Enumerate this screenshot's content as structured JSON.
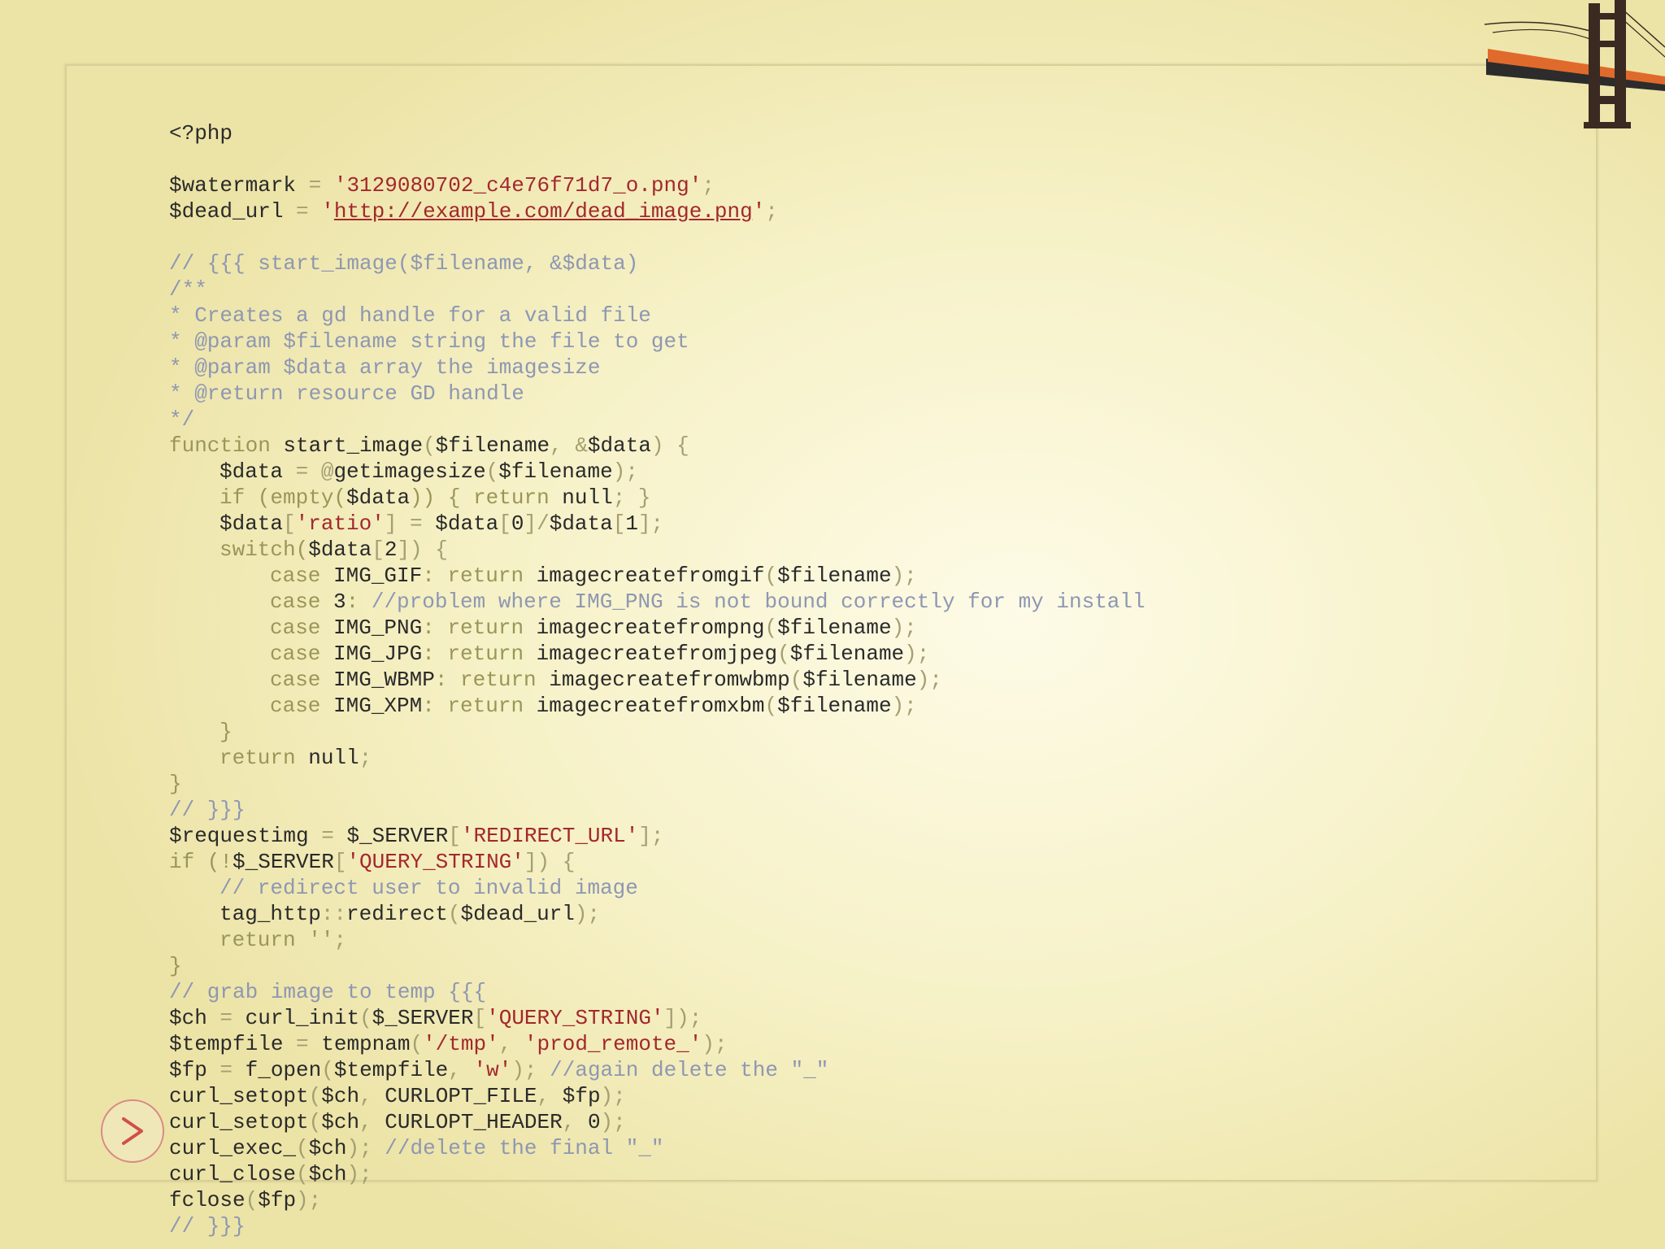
{
  "colors": {
    "background": "#f6f1c6",
    "frame": "#d9cf98",
    "default_text": "#2a2a2a",
    "keyword": "#9a9658",
    "string": "#a3282e",
    "comment": "#8e97b2",
    "bridge_orange": "#e06a2c",
    "bridge_tower": "#3a2a22",
    "next_button": "#d0504a"
  },
  "icons": {
    "corner_illustration": "golden-gate-bridge-icon",
    "navigation": "next-arrow-icon"
  },
  "code": {
    "line1": "<?php",
    "line3": {
      "var": "$watermark",
      "op": " = ",
      "str": "'3129080702_c4e76f71d7_o.png'",
      "end": ";"
    },
    "line4": {
      "var": "$dead_url",
      "op": " = ",
      "q1": "'",
      "url": "http://example.com/dead_image.png",
      "q2": "'",
      "end": ";"
    },
    "line6": "// {{{ start_image($filename, &$data)",
    "line7": "/**",
    "line8": "* Creates a gd handle for a valid file",
    "line9": "* @param $filename string the file to get",
    "line10": "* @param $data array the imagesize",
    "line11": "* @return resource GD handle",
    "line12": "*/",
    "line13": {
      "kw": "function",
      "name": " start_image",
      "p1": "(",
      "a1": "$filename",
      "c": ", &",
      "a2": "$data",
      "p2": ") {"
    },
    "line14": {
      "var": "$data",
      "op": " = @",
      "fn": "getimagesize",
      "p1": "(",
      "a": "$filename",
      "p2": ");"
    },
    "line15": {
      "kw1": "if (empty(",
      "var": "$data",
      "kw2": ")) { return ",
      "val": "null",
      "end": "; }"
    },
    "line16": {
      "var": "$data",
      "b1": "[",
      "str": "'ratio'",
      "b2": "] = ",
      "v2": "$data",
      "b3": "[",
      "n0": "0",
      "b4": "]/",
      "v3": "$data",
      "b5": "[",
      "n1": "1",
      "b6": "];"
    },
    "line17": {
      "kw": "switch(",
      "var": "$data",
      "b1": "[",
      "n": "2",
      "b2": "]) {"
    },
    "line18": {
      "kw": "case ",
      "const": "IMG_GIF",
      "mid": ": return ",
      "fn": "imagecreatefromgif",
      "p1": "(",
      "a": "$filename",
      "p2": ");"
    },
    "line19": {
      "kw": "case ",
      "const": "3",
      "mid": ": ",
      "cm": "//problem where IMG_PNG is not bound correctly for my install"
    },
    "line20": {
      "kw": "case ",
      "const": "IMG_PNG",
      "mid": ": return ",
      "fn": "imagecreatefrompng",
      "p1": "(",
      "a": "$filename",
      "p2": ");"
    },
    "line21": {
      "kw": "case ",
      "const": "IMG_JPG",
      "mid": ": return ",
      "fn": "imagecreatefromjpeg",
      "p1": "(",
      "a": "$filename",
      "p2": ");"
    },
    "line22": {
      "kw": "case ",
      "const": "IMG_WBMP",
      "mid": ": return ",
      "fn": "imagecreatefromwbmp",
      "p1": "(",
      "a": "$filename",
      "p2": ");"
    },
    "line23": {
      "kw": "case ",
      "const": "IMG_XPM",
      "mid": ": return ",
      "fn": "imagecreatefromxbm",
      "p1": "(",
      "a": "$filename",
      "p2": ");"
    },
    "line24": "}",
    "line25": {
      "kw": "return ",
      "val": "null",
      "end": ";"
    },
    "line26": "}",
    "line27": "// }}}",
    "line28": {
      "var": "$requestimg",
      "op": " = ",
      "var2": "$_SERVER",
      "b1": "[",
      "str": "'REDIRECT_URL'",
      "b2": "];"
    },
    "line29": {
      "kw": "if (!",
      "var": "$_SERVER",
      "b1": "[",
      "str": "'QUERY_STRING'",
      "b2": "]) {"
    },
    "line30": "// redirect user to invalid image",
    "line31": {
      "cls": "tag_http",
      "op": "::",
      "fn": "redirect",
      "p1": "(",
      "a": "$dead_url",
      "p2": ");"
    },
    "line32": {
      "kw": "return ''",
      "end": ";"
    },
    "line33": "}",
    "line34": "// grab image to temp {{{",
    "line35": {
      "var": "$ch",
      "op": " = ",
      "fn": "curl_init",
      "p1": "(",
      "a": "$_SERVER",
      "b1": "[",
      "str": "'QUERY_STRING'",
      "b2": "]);"
    },
    "line36": {
      "var": "$tempfile",
      "op": " = ",
      "fn": "tempnam",
      "p1": "(",
      "s1": "'/tmp'",
      "c": ", ",
      "s2": "'prod_remote_'",
      "p2": ");"
    },
    "line37": {
      "var": "$fp",
      "op": " = ",
      "fn": "f_open",
      "p1": "(",
      "a": "$tempfile",
      "c": ", ",
      "s": "'w'",
      "p2": "); ",
      "cm": "//again delete the \"_\""
    },
    "line38": {
      "fn": "curl_setopt",
      "p1": "(",
      "a1": "$ch",
      "c1": ", ",
      "a2": "CURLOPT_FILE",
      "c2": ", ",
      "a3": "$fp",
      "p2": ");"
    },
    "line39": {
      "fn": "curl_setopt",
      "p1": "(",
      "a1": "$ch",
      "c1": ", ",
      "a2": "CURLOPT_HEADER",
      "c2": ", ",
      "a3": "0",
      "p2": ");"
    },
    "line40": {
      "fn": "curl_exec_",
      "p1": "(",
      "a": "$ch",
      "p2": "); ",
      "cm": "//delete the final \"_\""
    },
    "line41": {
      "fn": "curl_close",
      "p1": "(",
      "a": "$ch",
      "p2": ");"
    },
    "line42": {
      "fn": "fclose",
      "p1": "(",
      "a": "$fp",
      "p2": ");"
    },
    "line43": "// }}}"
  }
}
